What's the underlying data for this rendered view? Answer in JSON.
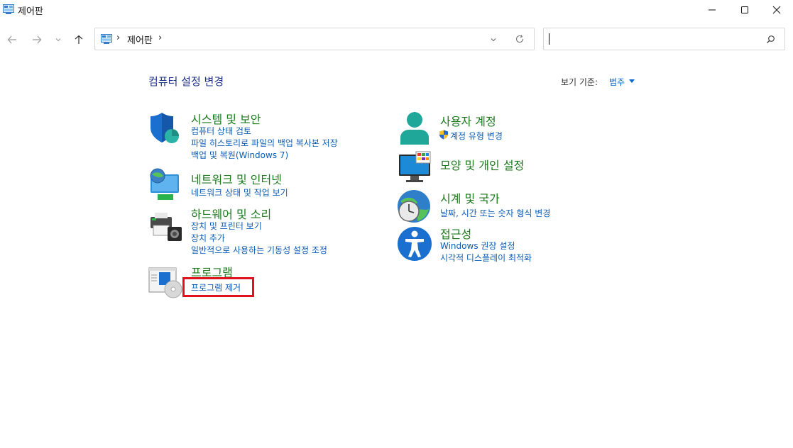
{
  "window": {
    "title": "제어판"
  },
  "nav": {
    "back_icon": "arrow-left-icon",
    "forward_icon": "arrow-right-icon",
    "recent_icon": "chevron-down-icon",
    "up_icon": "arrow-up-icon"
  },
  "address": {
    "crumbs": [
      "제어판"
    ],
    "sep": "›"
  },
  "search": {
    "value": ""
  },
  "main": {
    "title": "컴퓨터 설정 변경",
    "view_by_label": "보기 기준:",
    "view_by_value": "범주"
  },
  "categories": {
    "system": {
      "title": "시스템 및 보안",
      "links": [
        "컴퓨터 상태 검토",
        "파일 히스토리로 파일의 백업 복사본 저장",
        "백업 및 복원(Windows 7)"
      ]
    },
    "network": {
      "title": "네트워크 및 인터넷",
      "links": [
        "네트워크 상태 및 작업 보기"
      ]
    },
    "hardware": {
      "title": "하드웨어 및 소리",
      "links": [
        "장치 및 프린터 보기",
        "장치 추가",
        "일반적으로 사용하는 기동성 설정 조정"
      ]
    },
    "programs": {
      "title": "프로그램",
      "links": [
        "프로그램 제거"
      ]
    },
    "users": {
      "title": "사용자 계정",
      "links": [
        "계정 유형 변경"
      ]
    },
    "appearance": {
      "title": "모양 및 개인 설정",
      "links": []
    },
    "clock": {
      "title": "시계 및 국가",
      "links": [
        "날짜, 시간 또는 숫자 형식 변경"
      ]
    },
    "ease": {
      "title": "접근성",
      "links": [
        "Windows 권장 설정",
        "시각적 디스플레이 최적화"
      ]
    }
  },
  "colors": {
    "category_title": "#1c7a1c",
    "link": "#0a5bb5",
    "highlight_box": "#e0131d",
    "main_title": "#1e3287"
  }
}
